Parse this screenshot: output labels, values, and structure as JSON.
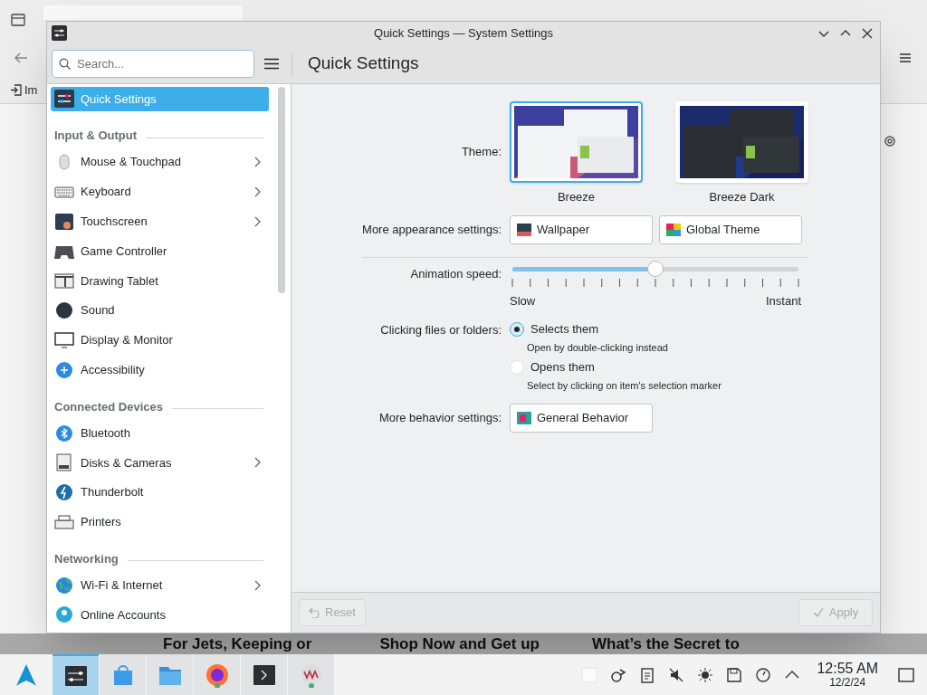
{
  "background": {
    "bookmark_text": "Im",
    "headlines": [
      "For Jets, Keeping or",
      "Shop Now and Get up",
      "What’s the Secret to"
    ]
  },
  "window": {
    "title": "Quick Settings — System Settings"
  },
  "sidebar": {
    "search": {
      "placeholder": "Search..."
    },
    "items": [
      {
        "kind": "item",
        "label": "Quick Settings",
        "selected": true,
        "has_children": false
      },
      {
        "kind": "header",
        "label": "Input & Output"
      },
      {
        "kind": "item",
        "label": "Mouse & Touchpad",
        "selected": false,
        "has_children": true
      },
      {
        "kind": "item",
        "label": "Keyboard",
        "selected": false,
        "has_children": true
      },
      {
        "kind": "item",
        "label": "Touchscreen",
        "selected": false,
        "has_children": true
      },
      {
        "kind": "item",
        "label": "Game Controller",
        "selected": false,
        "has_children": false
      },
      {
        "kind": "item",
        "label": "Drawing Tablet",
        "selected": false,
        "has_children": false
      },
      {
        "kind": "item",
        "label": "Sound",
        "selected": false,
        "has_children": false
      },
      {
        "kind": "item",
        "label": "Display & Monitor",
        "selected": false,
        "has_children": false
      },
      {
        "kind": "item",
        "label": "Accessibility",
        "selected": false,
        "has_children": false
      },
      {
        "kind": "header",
        "label": "Connected Devices"
      },
      {
        "kind": "item",
        "label": "Bluetooth",
        "selected": false,
        "has_children": false
      },
      {
        "kind": "item",
        "label": "Disks & Cameras",
        "selected": false,
        "has_children": true
      },
      {
        "kind": "item",
        "label": "Thunderbolt",
        "selected": false,
        "has_children": false
      },
      {
        "kind": "item",
        "label": "Printers",
        "selected": false,
        "has_children": false
      },
      {
        "kind": "header",
        "label": "Networking"
      },
      {
        "kind": "item",
        "label": "Wi-Fi & Internet",
        "selected": false,
        "has_children": true
      },
      {
        "kind": "item",
        "label": "Online Accounts",
        "selected": false,
        "has_children": false
      }
    ]
  },
  "page": {
    "title": "Quick Settings",
    "theme": {
      "label": "Theme:",
      "options": [
        {
          "label": "Breeze",
          "selected": true
        },
        {
          "label": "Breeze Dark",
          "selected": false
        }
      ]
    },
    "appearance": {
      "label": "More appearance settings:",
      "buttons": [
        "Wallpaper",
        "Global Theme"
      ]
    },
    "animation": {
      "label": "Animation speed:",
      "level": 0.5,
      "min_label": "Slow",
      "max_label": "Instant"
    },
    "clicking": {
      "label": "Clicking files or folders:",
      "options": [
        {
          "label": "Selects them",
          "description": "Open by double-clicking instead",
          "selected": true
        },
        {
          "label": "Opens them",
          "description": "Select by clicking on item's selection marker",
          "selected": false
        }
      ]
    },
    "behavior": {
      "label": "More behavior settings:",
      "button": "General Behavior"
    }
  },
  "footer": {
    "reset": {
      "label": "Reset",
      "disabled": true
    },
    "apply": {
      "label": "Apply",
      "disabled": true
    }
  },
  "taskbar": {
    "apps": [
      {
        "selected": false
      },
      {
        "selected": true
      },
      {
        "selected": false
      },
      {
        "selected": false
      },
      {
        "selected": false
      },
      {
        "selected": false
      },
      {
        "selected": false
      }
    ],
    "clock": {
      "time": "12:55 AM",
      "date": "12/2/24"
    }
  }
}
